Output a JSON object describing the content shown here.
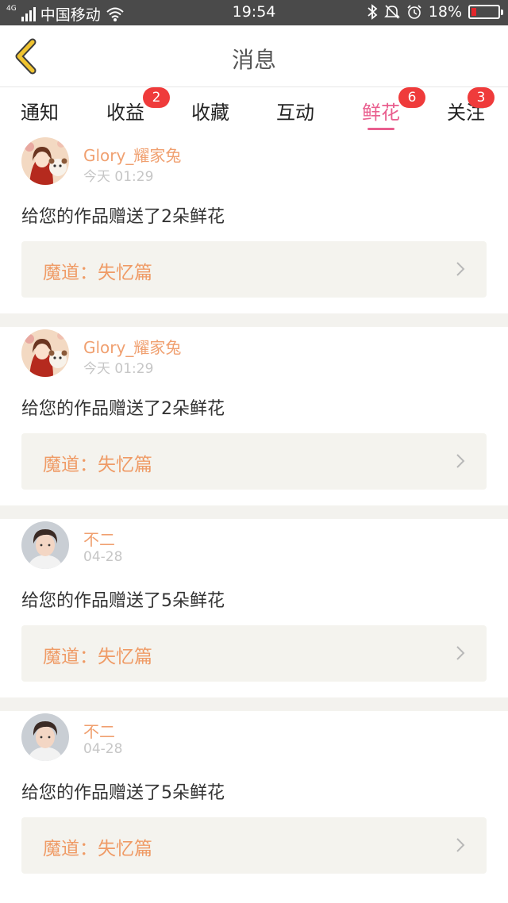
{
  "status_bar": {
    "network": "4G",
    "carrier": "中国移动",
    "time": "19:54",
    "battery": "18%",
    "battery_level": 0.18,
    "icons": [
      "wifi-icon",
      "bluetooth-icon",
      "mute-bell-icon",
      "alarm-icon"
    ]
  },
  "nav": {
    "title": "消息",
    "back_icon": "chevron-left-icon",
    "accent": "#f0c430"
  },
  "tabs": [
    {
      "label": "通知",
      "badge": "",
      "active": false
    },
    {
      "label": "收益",
      "badge": "2",
      "active": false
    },
    {
      "label": "收藏",
      "badge": "",
      "active": false
    },
    {
      "label": "互动",
      "badge": "",
      "active": false
    },
    {
      "label": "鲜花",
      "badge": "6",
      "active": true
    },
    {
      "label": "关注",
      "badge": "3",
      "active": false
    }
  ],
  "colors": {
    "active_tab": "#e95e8e",
    "badge": "#ef3b3b",
    "username": "#f0a070",
    "work_title": "#ef9b66"
  },
  "feed": [
    {
      "username": "Glory_耀家兔",
      "time": "今天 01:29",
      "message": "给您的作品赠送了2朵鲜花",
      "work": "魔道：失忆篇",
      "avatar": "avatar-girl-icon"
    },
    {
      "username": "Glory_耀家兔",
      "time": "今天 01:29",
      "message": "给您的作品赠送了2朵鲜花",
      "work": "魔道：失忆篇",
      "avatar": "avatar-girl-icon"
    },
    {
      "username": "不二",
      "time": "04-28",
      "message": "给您的作品赠送了5朵鲜花",
      "work": "魔道：失忆篇",
      "avatar": "avatar-boy-icon"
    },
    {
      "username": "不二",
      "time": "04-28",
      "message": "给您的作品赠送了5朵鲜花",
      "work": "魔道：失忆篇",
      "avatar": "avatar-boy-icon"
    }
  ]
}
